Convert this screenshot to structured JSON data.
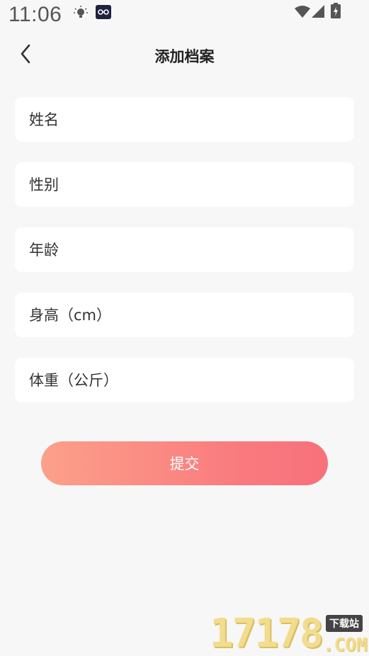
{
  "status_bar": {
    "time": "11:06",
    "icons": [
      "bulb-icon",
      "app-notification-icon",
      "wifi-icon",
      "signal-icon",
      "battery-charging-icon"
    ]
  },
  "header": {
    "title": "添加档案",
    "back_icon": "chevron-left-icon"
  },
  "form": {
    "name_placeholder": "姓名",
    "gender_placeholder": "性别",
    "age_placeholder": "年龄",
    "height_placeholder": "身高（cm）",
    "weight_placeholder": "体重（公斤）"
  },
  "submit_label": "提交",
  "watermark": {
    "digits": "17178",
    "badge": "下载站",
    "suffix": ".COM"
  },
  "colors": {
    "background": "#f7f7f7",
    "field_background": "#ffffff",
    "button_gradient_start": "#fca08a",
    "button_gradient_end": "#f8717c"
  }
}
